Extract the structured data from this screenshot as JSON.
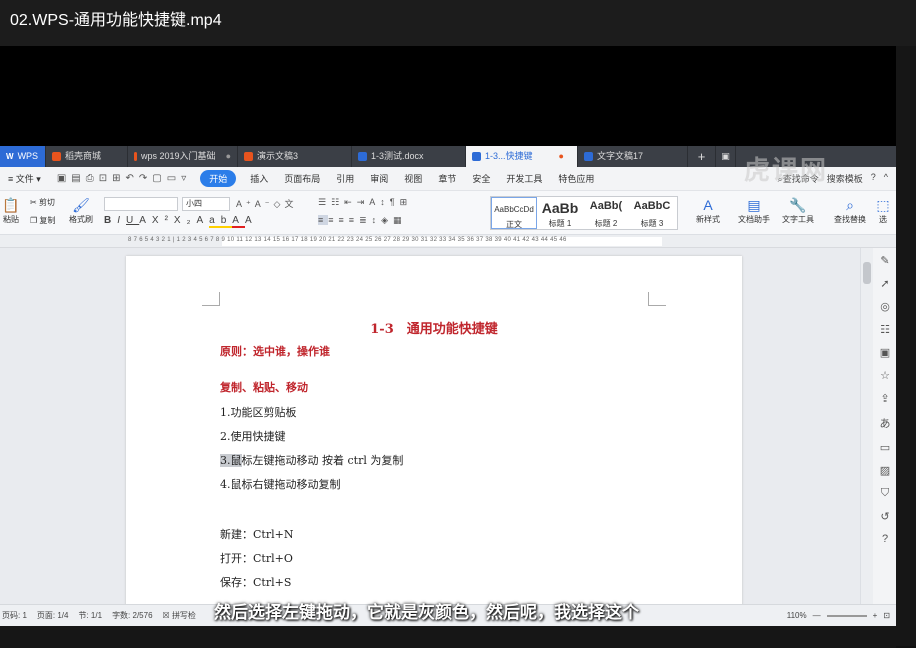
{
  "player": {
    "title": "02.WPS-通用功能快捷键.mp4"
  },
  "tabs": [
    {
      "label": "WPS",
      "color": "#2d6bd6"
    },
    {
      "label": "稻壳商城",
      "color": "#e8541e"
    },
    {
      "label": "wps 2019入门基础",
      "color": "#e8541e"
    },
    {
      "label": "演示文稿3",
      "color": "#e8541e"
    },
    {
      "label": "1-3测试.docx",
      "color": "#2d6bd6"
    },
    {
      "label": "1-3...快捷键",
      "color": "#2d6bd6"
    },
    {
      "label": "文字文稿17",
      "color": "#2d6bd6"
    }
  ],
  "menubar": {
    "file": "文件",
    "items": [
      "开始",
      "插入",
      "页面布局",
      "引用",
      "审阅",
      "视图",
      "章节",
      "安全",
      "开发工具",
      "特色应用"
    ],
    "right": [
      "查找命令",
      "搜索模板"
    ]
  },
  "ribbon": {
    "paste": "粘贴",
    "cut": "剪切",
    "copy": "复制",
    "format_painter": "格式刷",
    "font_size": "小四",
    "styles": [
      {
        "preview": "AaBbCcDd",
        "name": "正文"
      },
      {
        "preview": "AaBb",
        "name": "标题 1"
      },
      {
        "preview": "AaBb(",
        "name": "标题 2"
      },
      {
        "preview": "AaBbC",
        "name": "标题 3"
      }
    ],
    "new_style": "新样式",
    "doc_helper": "文档助手",
    "text_tools": "文字工具",
    "find_replace": "查找替换",
    "select": "选"
  },
  "ruler": {
    "labels": "8 7 6 5 4 3 2 1 | 1 2 3 4 5 6 7 8 9 10 11 12 13 14 15 16 17 18 19 20 21 22 23 24 25 26 27 28 29 30 31 32 33 34 35 36 37 38 39 40 41 42 43 44 45 46"
  },
  "document": {
    "title": "1-3　通用功能快捷键",
    "principle": "原则：选中谁，操作谁",
    "section": "复制、粘贴、移动",
    "items": [
      "1.功能区剪贴板",
      "2.使用快捷键",
      "3.鼠标左键拖动移动  按着 ctrl 为复制",
      "4.鼠标右键拖动移动复制"
    ],
    "item3_sel": "3.鼠",
    "item3_rest": "标左键拖动移动  按着 ctrl 为复制",
    "shortcuts": [
      "新建：Ctrl+N",
      "打开：Ctrl+O",
      "保存：Ctrl+S"
    ]
  },
  "status": {
    "page_num": "页码: 1",
    "pages": "页面: 1/4",
    "section": "节: 1/1",
    "words": "字数: 2/576",
    "spell": "拼写检",
    "zoom": "110%"
  },
  "subtitle": "然后选择左键拖动，它就是灰颜色，然后呢，我选择这个",
  "watermark": "虎课网"
}
